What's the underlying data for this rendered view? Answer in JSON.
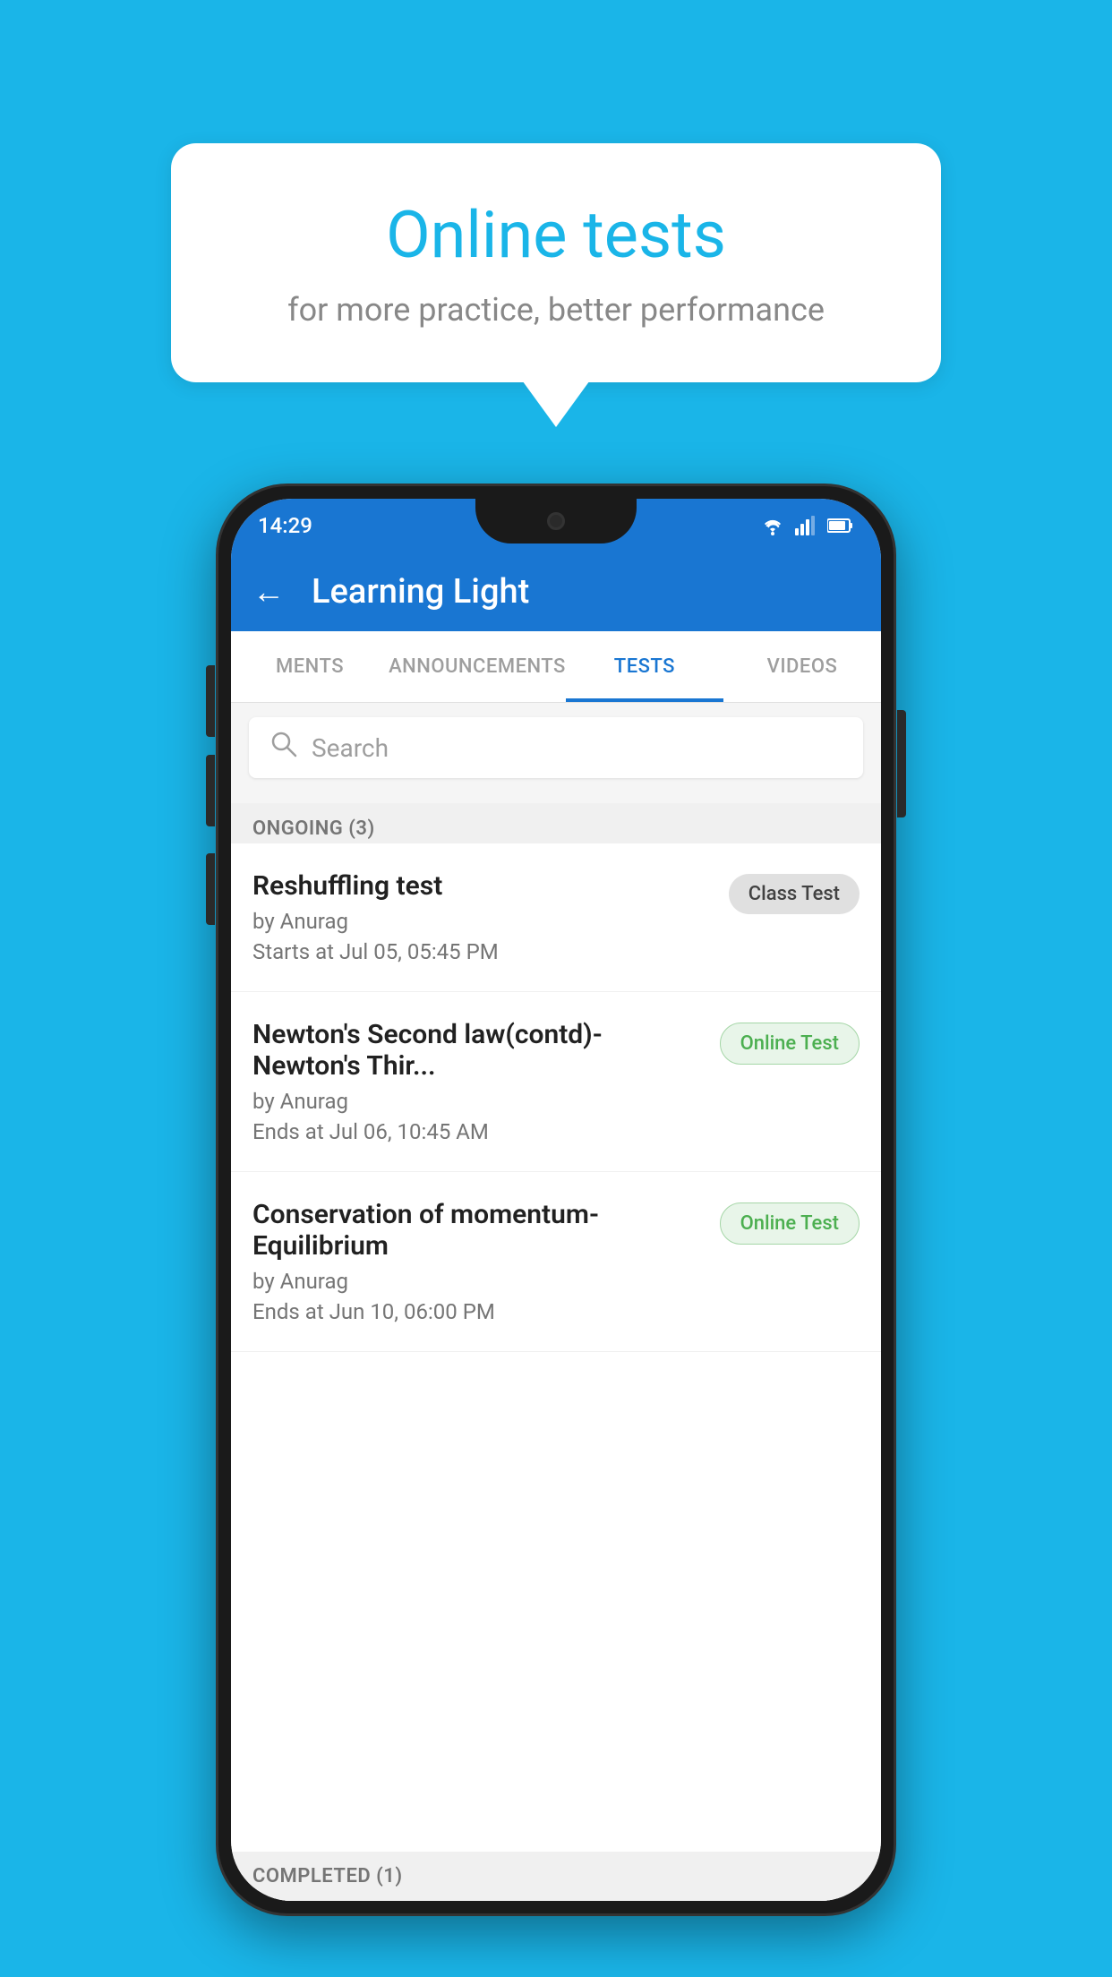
{
  "background_color": "#1ab5e8",
  "bubble": {
    "title": "Online tests",
    "subtitle": "for more practice, better performance"
  },
  "status_bar": {
    "time": "14:29",
    "wifi": "▼",
    "signal": "▲",
    "battery": "▐"
  },
  "app_header": {
    "back_label": "←",
    "title": "Learning Light"
  },
  "tabs": [
    {
      "label": "MENTS",
      "active": false
    },
    {
      "label": "ANNOUNCEMENTS",
      "active": false
    },
    {
      "label": "TESTS",
      "active": true
    },
    {
      "label": "VIDEOS",
      "active": false
    }
  ],
  "search": {
    "placeholder": "Search"
  },
  "ongoing_section": {
    "label": "ONGOING (3)"
  },
  "test_items": [
    {
      "name": "Reshuffling test",
      "author": "by Anurag",
      "time_label": "Starts at",
      "time": "Jul 05, 05:45 PM",
      "badge": "Class Test",
      "badge_type": "class"
    },
    {
      "name": "Newton's Second law(contd)-Newton's Thir...",
      "author": "by Anurag",
      "time_label": "Ends at",
      "time": "Jul 06, 10:45 AM",
      "badge": "Online Test",
      "badge_type": "online"
    },
    {
      "name": "Conservation of momentum-Equilibrium",
      "author": "by Anurag",
      "time_label": "Ends at",
      "time": "Jun 10, 06:00 PM",
      "badge": "Online Test",
      "badge_type": "online"
    }
  ],
  "completed_section": {
    "label": "COMPLETED (1)"
  }
}
